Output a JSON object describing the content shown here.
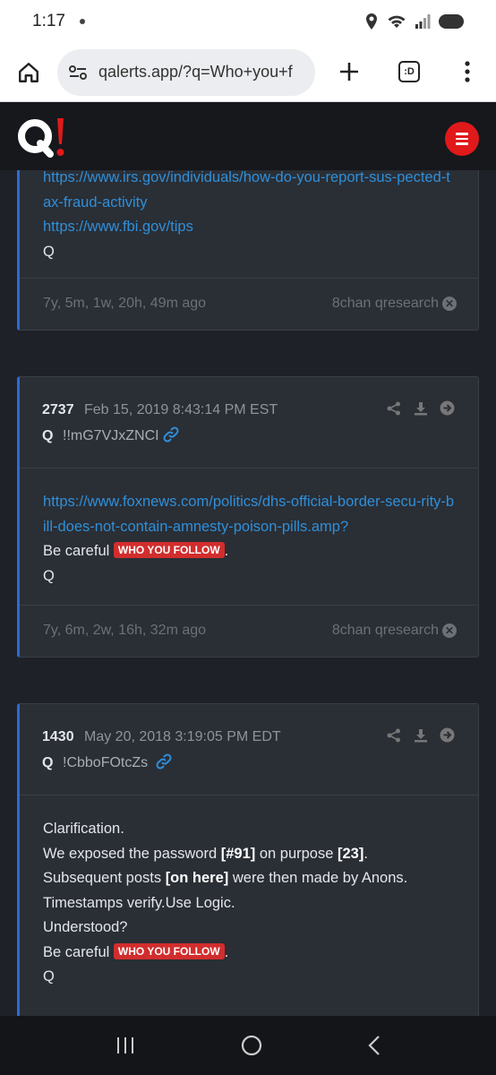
{
  "status": {
    "time": "1:17"
  },
  "browser": {
    "url": "qalerts.app/?q=Who+you+f",
    "tab_count": ":D"
  },
  "site": {
    "logo_text": "Q!"
  },
  "posts": [
    {
      "links": [
        "https://www.irs.gov/individuals/how-do-you-report-sus-pected-tax-fraud-activity",
        "https://www.fbi.gov/tips"
      ],
      "sign": "Q",
      "ago": "7y, 5m, 1w, 20h, 49m ago",
      "board": "8chan qresearch"
    },
    {
      "number": "2737",
      "date": "Feb 15, 2019 8:43:14 PM EST",
      "author": "Q",
      "tripcode": "!!mG7VJxZNCI",
      "link": "https://www.foxnews.com/politics/dhs-official-border-secu-rity-bill-does-not-contain-amnesty-poison-pills.amp?",
      "careful_prefix": "Be careful ",
      "badge": "WHO YOU FOLLOW",
      "careful_suffix": ".",
      "sign": "Q",
      "ago": "7y, 6m, 2w, 16h, 32m ago",
      "board": "8chan qresearch"
    },
    {
      "number": "1430",
      "date": "May 20, 2018 3:19:05 PM EDT",
      "author": "Q",
      "tripcode": "!CbboFOtcZs",
      "line1": "Clarification.",
      "line2_a": "We exposed the password ",
      "line2_b": "[#91]",
      "line2_c": " on purpose ",
      "line2_d": "[23]",
      "line2_e": ".",
      "line3_a": "Subsequent posts ",
      "line3_b": "[on here]",
      "line3_c": " were then made by Anons.",
      "line4": "Timestamps verify.Use Logic.",
      "line5": "Understood?",
      "careful_prefix": "Be careful ",
      "badge": "WHO YOU FOLLOW",
      "careful_suffix": ".",
      "sign": "Q"
    }
  ],
  "colors": {
    "accent": "#2d6bd3",
    "link": "#2f8fd9",
    "badge": "#d22d2d",
    "logo_red": "#e0191a"
  }
}
